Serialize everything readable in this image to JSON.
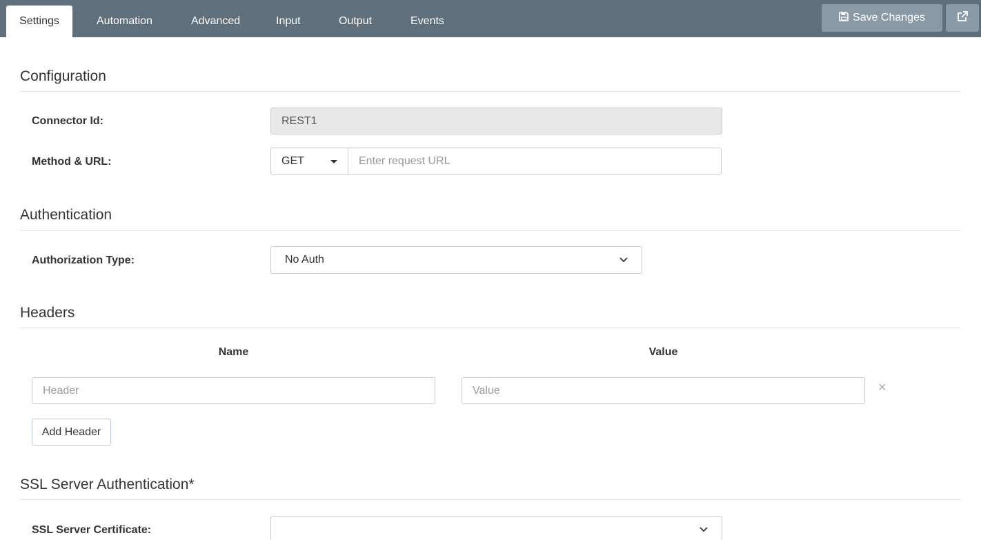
{
  "tabs": [
    {
      "label": "Settings",
      "active": true
    },
    {
      "label": "Automation"
    },
    {
      "label": "Advanced"
    },
    {
      "label": "Input"
    },
    {
      "label": "Output"
    },
    {
      "label": "Events"
    }
  ],
  "toolbar": {
    "save_label": "Save Changes",
    "save_icon": "floppy-disk-icon",
    "external_icon": "external-link-icon"
  },
  "configuration": {
    "title": "Configuration",
    "connector_id_label": "Connector Id:",
    "connector_id_value": "REST1",
    "method_url_label": "Method & URL:",
    "method_value": "GET",
    "url_placeholder": "Enter request URL"
  },
  "authentication": {
    "title": "Authentication",
    "auth_type_label": "Authorization Type:",
    "auth_type_value": "No Auth"
  },
  "headers": {
    "title": "Headers",
    "name_column": "Name",
    "value_column": "Value",
    "header_placeholder": "Header",
    "value_placeholder": "Value",
    "remove_symbol": "×",
    "add_label": "Add Header"
  },
  "ssl": {
    "title": "SSL Server Authentication*",
    "cert_label": "SSL Server Certificate:",
    "cert_value": ""
  },
  "colors": {
    "topbar": "#5f6f7c",
    "button": "#8a99a6"
  }
}
